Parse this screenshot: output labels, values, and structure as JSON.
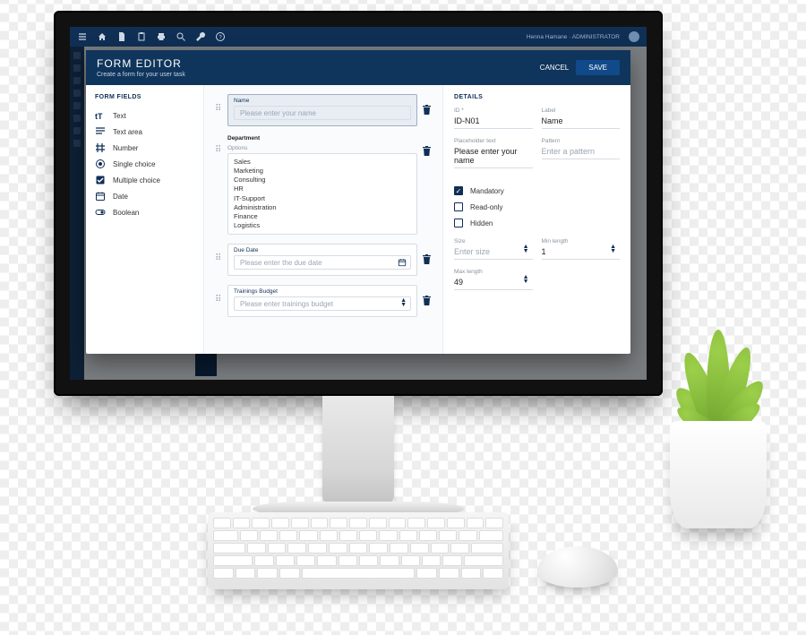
{
  "topbar": {
    "user_text": "Henna Hamane · ADMINISTRATOR"
  },
  "modal": {
    "title": "FORM EDITOR",
    "subtitle": "Create a form for your user task",
    "cancel_label": "CANCEL",
    "save_label": "SAVE"
  },
  "fields_section": {
    "title": "FORM FIELDS",
    "items": [
      {
        "label": "Text"
      },
      {
        "label": "Text area"
      },
      {
        "label": "Number"
      },
      {
        "label": "Single choice"
      },
      {
        "label": "Multiple choice"
      },
      {
        "label": "Date"
      },
      {
        "label": "Boolean"
      }
    ]
  },
  "canvas": {
    "blocks": [
      {
        "kind": "text",
        "label": "Name",
        "placeholder": "Please enter your name",
        "selected": true
      },
      {
        "kind": "select",
        "label": "Department",
        "options_label": "Options",
        "options": [
          "Sales",
          "Marketing",
          "Consulting",
          "HR",
          "IT-Support",
          "Administration",
          "Finance",
          "Logistics"
        ]
      },
      {
        "kind": "date",
        "label": "Due Date",
        "placeholder": "Please enter the due date"
      },
      {
        "kind": "number",
        "label": "Trainings Budget",
        "placeholder": "Please enter trainings budget"
      }
    ]
  },
  "details": {
    "title": "DETAILS",
    "id_label": "ID *",
    "id_value": "ID-N01",
    "label_label": "Label",
    "label_value": "Name",
    "placeholder_label": "Placeholder text",
    "placeholder_value": "Please enter your name",
    "pattern_label": "Pattern",
    "pattern_placeholder": "Enter a pattern",
    "mandatory_label": "Mandatory",
    "mandatory_checked": true,
    "readonly_label": "Read-only",
    "readonly_checked": false,
    "hidden_label": "Hidden",
    "hidden_checked": false,
    "size_label": "Size",
    "size_placeholder": "Enter size",
    "minlen_label": "Min length",
    "minlen_value": "1",
    "maxlen_label": "Max length",
    "maxlen_value": "49"
  }
}
